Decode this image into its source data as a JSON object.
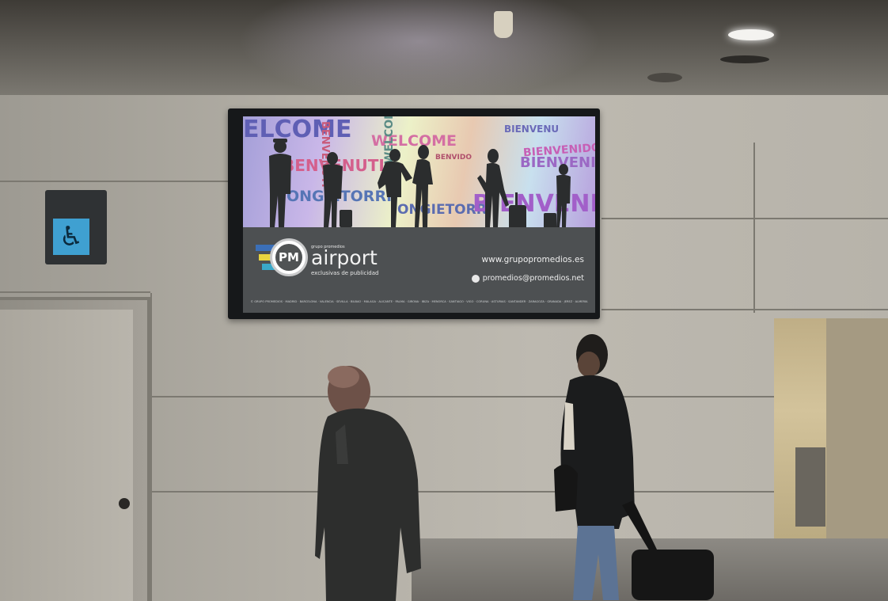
{
  "scene": {
    "description_tag": "airport-corridor-billboard"
  },
  "billboard": {
    "collage_words": [
      {
        "text": "ELCOME",
        "color": "#5f5fb4"
      },
      {
        "text": "WELCOME",
        "color": "#d46fa3"
      },
      {
        "text": "BIENVENIDO",
        "color": "#c75fb5"
      },
      {
        "text": "BENVENUTI",
        "color": "#d45f8c"
      },
      {
        "text": "ONGIETORRI",
        "color": "#5675b5"
      },
      {
        "text": "ONGIETORRI",
        "color": "#5b6cb0"
      },
      {
        "text": "BIENVENIDO",
        "color": "#a25fc9"
      },
      {
        "text": "BIENVENIDO",
        "color": "#9b68c4"
      },
      {
        "text": "WELCOME",
        "color": "#5a8b85"
      },
      {
        "text": "BENVIDO",
        "color": "#b0506c"
      },
      {
        "text": "BENVENUTI",
        "color": "#c85a7a"
      },
      {
        "text": "BIENVENU",
        "color": "#6a6ab8"
      }
    ],
    "logo": {
      "mark": "PM",
      "name": "airport",
      "top_small": "grupo promedios",
      "tagline": "exclusivas de publicidad"
    },
    "website": "www.grupopromedios.es",
    "email": "promedios@promedios.net",
    "footer": "© GRUPO PROMEDIOS · MADRID · BARCELONA · VALENCIA · SEVILLA · BILBAO · MÁLAGA · ALICANTE · PALMA · GIRONA · IBIZA · MENORCA · SANTIAGO · VIGO · CORUÑA · ASTURIAS · SANTANDER · ZARAGOZA · GRANADA · JEREZ · ALMERÍA"
  },
  "signage": {
    "icon": "wheelchair-accessibility-icon",
    "color": "#3fa0d1"
  }
}
